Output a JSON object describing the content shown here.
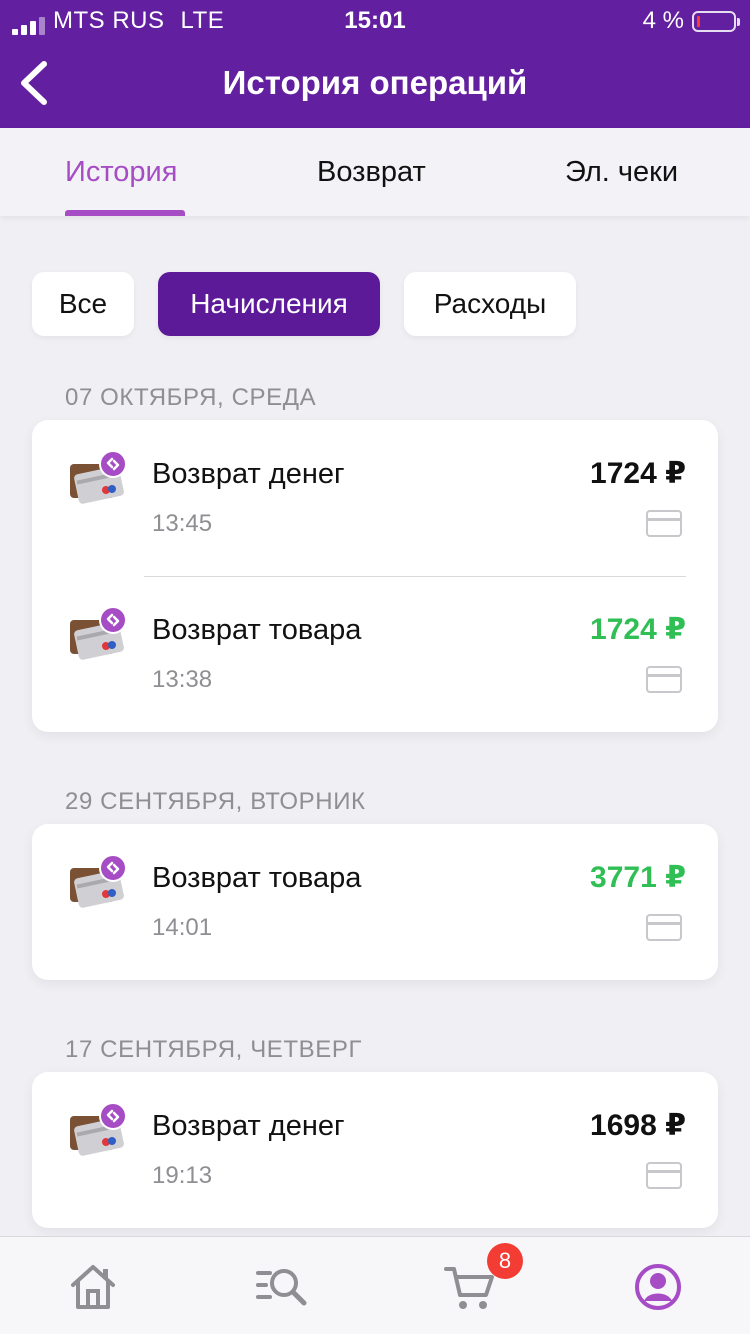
{
  "status_bar": {
    "carrier": "MTS RUS",
    "network": "LTE",
    "time": "15:01",
    "battery": "4 %"
  },
  "header": {
    "title": "История операций"
  },
  "tabs": [
    {
      "label": "История",
      "active": true
    },
    {
      "label": "Возврат",
      "active": false
    },
    {
      "label": "Эл. чеки",
      "active": false
    }
  ],
  "filters": [
    {
      "label": "Все",
      "active": false
    },
    {
      "label": "Начисления",
      "active": true
    },
    {
      "label": "Расходы",
      "active": false
    }
  ],
  "sections": [
    {
      "date": "07 ОКТЯБРЯ, СРЕДА",
      "operations": [
        {
          "title": "Возврат денег",
          "time": "13:45",
          "amount": "1724 ₽",
          "amount_color": "#111111"
        },
        {
          "title": "Возврат товара",
          "time": "13:38",
          "amount": "1724 ₽",
          "amount_color": "#2fbf55"
        }
      ]
    },
    {
      "date": "29 СЕНТЯБРЯ, ВТОРНИК",
      "operations": [
        {
          "title": "Возврат товара",
          "time": "14:01",
          "amount": "3771 ₽",
          "amount_color": "#2fbf55"
        }
      ]
    },
    {
      "date": "17 СЕНТЯБРЯ, ЧЕТВЕРГ",
      "operations": [
        {
          "title": "Возврат денег",
          "time": "19:13",
          "amount": "1698 ₽",
          "amount_color": "#111111"
        }
      ]
    }
  ],
  "tabbar": {
    "items": [
      {
        "icon": "home-icon"
      },
      {
        "icon": "catalog-search-icon"
      },
      {
        "icon": "cart-icon"
      },
      {
        "icon": "profile-icon",
        "active": true
      }
    ],
    "cart_badge": "8"
  },
  "colors": {
    "header_bg": "#621fa0",
    "accent": "#a64cc5",
    "filter_active": "#5c1a99",
    "green_amount": "#2fbf55",
    "badge": "#f23c34"
  }
}
